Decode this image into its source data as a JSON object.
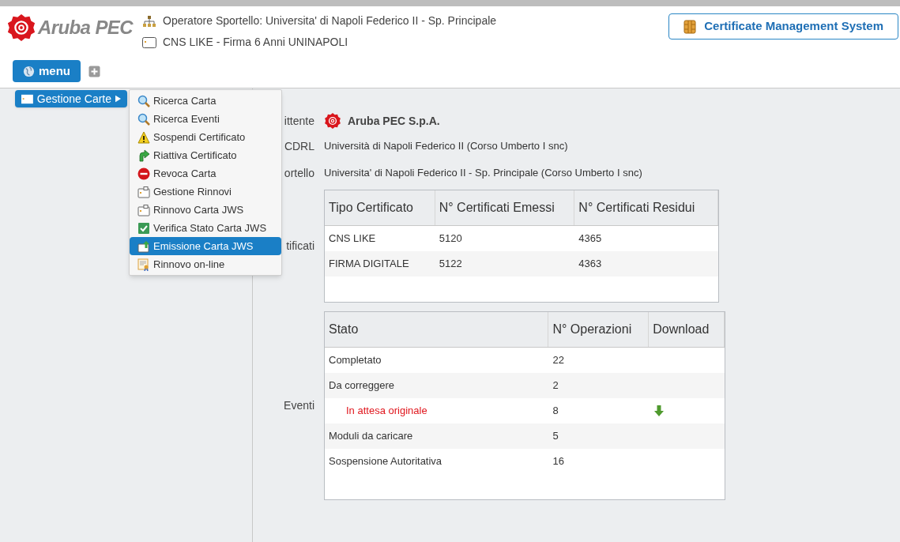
{
  "header": {
    "logo": "Aruba PEC",
    "operator": "Operatore Sportello: Universita' di Napoli Federico II - Sp. Principale",
    "profile": "CNS LIKE - Firma 6 Anni UNINAPOLI",
    "system_button": "Certificate Management System"
  },
  "menu": {
    "button": "menu",
    "submenu": {
      "label": "Gestione Carte",
      "expanded": true
    },
    "items": [
      {
        "label": "Ricerca Carta",
        "selected": false
      },
      {
        "label": "Ricerca Eventi",
        "selected": false
      },
      {
        "label": "Sospendi Certificato",
        "selected": false
      },
      {
        "label": "Riattiva Certificato",
        "selected": false
      },
      {
        "label": "Revoca Carta",
        "selected": false
      },
      {
        "label": "Gestione Rinnovi",
        "selected": false
      },
      {
        "label": "Rinnovo Carta JWS",
        "selected": false
      },
      {
        "label": "Verifica Stato Carta JWS",
        "selected": false
      },
      {
        "label": "Emissione Carta JWS",
        "selected": true
      },
      {
        "label": "Rinnovo on-line",
        "selected": false
      }
    ]
  },
  "details": {
    "issuer_label": "ittente",
    "issuer": "Aruba PEC S.p.A.",
    "cdrl_label": "CDRL",
    "cdrl": "Università di Napoli Federico II (Corso Umberto I snc)",
    "desk_label": "ortello",
    "desk": "Universita' di Napoli Federico II - Sp. Principale (Corso Umberto I snc)",
    "certificates_label": "tificati",
    "certificates": {
      "columns": [
        "Tipo Certificato",
        "N° Certificati Emessi",
        "N° Certificati Residui"
      ],
      "rows": [
        [
          "CNS LIKE",
          "5120",
          "4365"
        ],
        [
          "FIRMA DIGITALE",
          "5122",
          "4363"
        ]
      ]
    },
    "events_label": "Eventi",
    "events": {
      "columns": [
        "Stato",
        "N° Operazioni",
        "Download"
      ],
      "rows": [
        {
          "status": "Completato",
          "count": "22",
          "warning": false,
          "download": false
        },
        {
          "status": "Da correggere",
          "count": "2",
          "warning": false,
          "download": false
        },
        {
          "status": "In attesa originale",
          "count": "8",
          "warning": true,
          "download": true
        },
        {
          "status": "Moduli da caricare",
          "count": "5",
          "warning": false,
          "download": false
        },
        {
          "status": "Sospensione Autoritativa",
          "count": "16",
          "warning": false,
          "download": false
        }
      ]
    }
  }
}
